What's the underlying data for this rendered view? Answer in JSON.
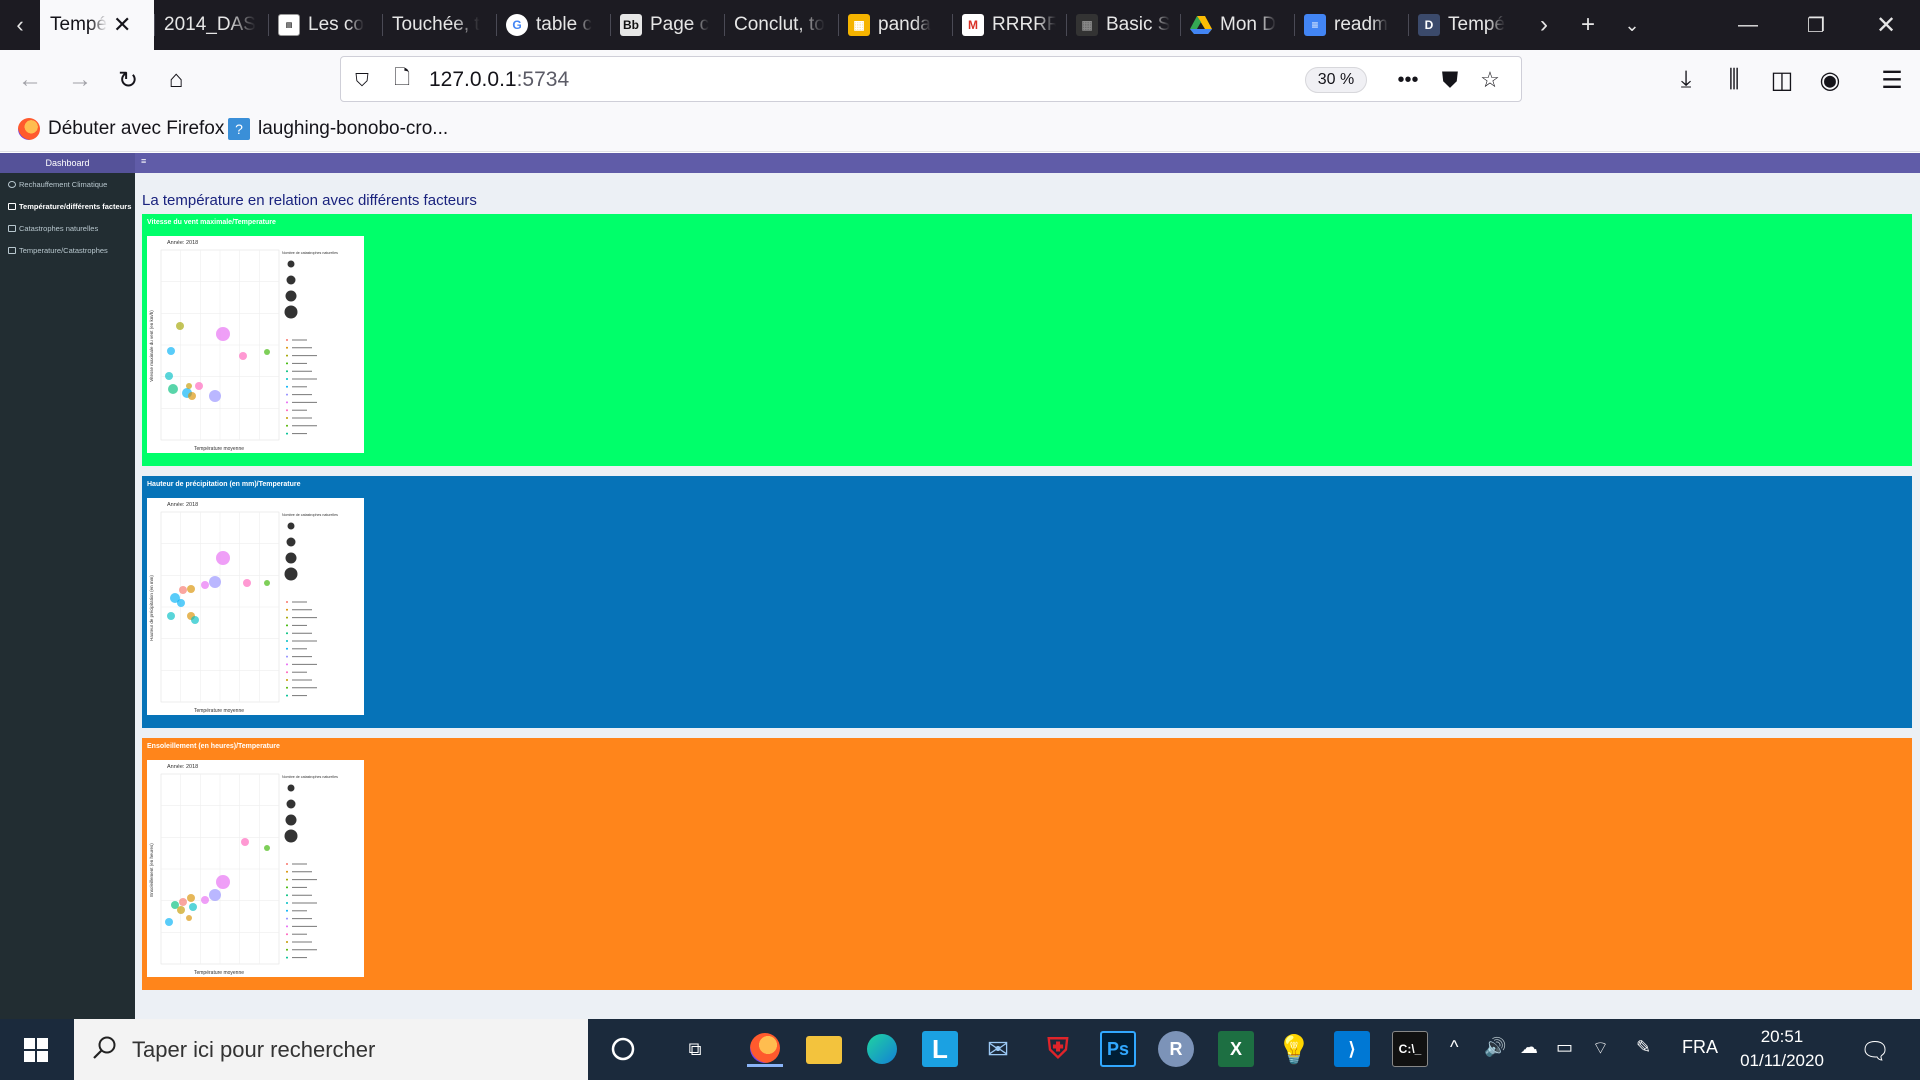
{
  "browser": {
    "tabs": [
      {
        "label": "Tempé",
        "active": true,
        "icon": "dashboard-tab-icon"
      },
      {
        "label": "2014_DAS",
        "icon": "none"
      },
      {
        "label": "Les co",
        "icon": "page-icon"
      },
      {
        "label": "Touchée, t",
        "icon": "none"
      },
      {
        "label": "table c",
        "icon": "google-icon"
      },
      {
        "label": "Page c",
        "icon": "bb-icon"
      },
      {
        "label": "Conclut, to",
        "icon": "none"
      },
      {
        "label": "panda",
        "icon": "kaggle-icon"
      },
      {
        "label": "RRRRR",
        "icon": "gmail-icon"
      },
      {
        "label": "Basic S",
        "icon": "kaggle-icon"
      },
      {
        "label": "Mon D",
        "icon": "drive-icon"
      },
      {
        "label": "readm",
        "icon": "docs-icon"
      },
      {
        "label": "Tempé",
        "icon": "d-icon"
      }
    ],
    "url_host": "127.0.0.1",
    "url_port": ":5734",
    "zoom": "30 %",
    "bookmarks": [
      {
        "label": "Débuter avec Firefox",
        "icon": "firefox-icon"
      },
      {
        "label": "laughing-bonobo-cro...",
        "icon": "unknown-site-icon"
      }
    ]
  },
  "dashboard": {
    "brand": "Dashboard",
    "hamburger": "≡",
    "sidebar": [
      {
        "label": "Rechauffement Climatique",
        "active": false
      },
      {
        "label": "Température/différents facteurs",
        "active": true
      },
      {
        "label": "Catastrophes naturelles",
        "active": false
      },
      {
        "label": "Temperature/Catastrophes",
        "active": false
      }
    ],
    "page_title": "La température en relation avec différents facteurs",
    "boxes": [
      {
        "title": "Vitesse du vent maximale/Temperature",
        "color": "#00ff6a"
      },
      {
        "title": "Hauteur de précipitation (en mm)/Temperature",
        "color": "#0673b8"
      },
      {
        "title": "Ensoleillement (en heures)/Temperature",
        "color": "#ff851b"
      }
    ],
    "plot_common": {
      "annee": "Année: 2018",
      "xlabel": "Température moyenne",
      "size_legend_title": "Nombre de catastrophes naturelles"
    },
    "ylabels": [
      "Vitesse maximale du vent (en km/h)",
      "Hauteur de précipitation (en mm)",
      "Ensoleillement (en heures)"
    ]
  },
  "taskbar": {
    "search_placeholder": "Taper ici pour rechercher",
    "language": "FRA",
    "time": "20:51",
    "date": "01/11/2020"
  }
}
